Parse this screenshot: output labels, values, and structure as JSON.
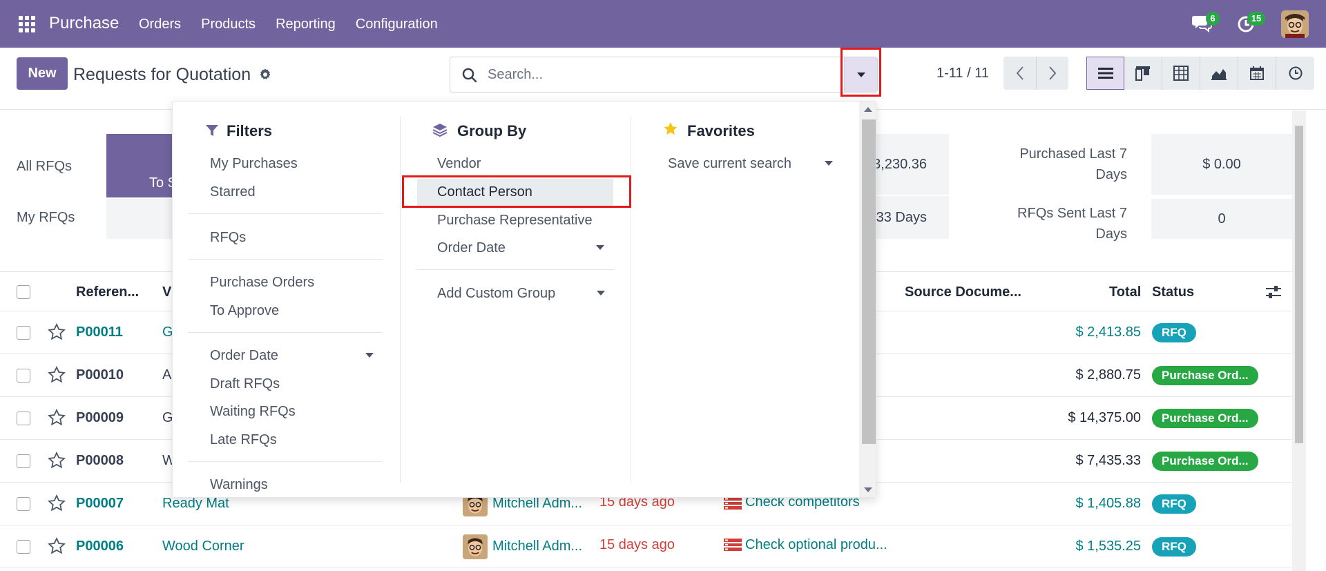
{
  "navbar": {
    "brand": "Purchase",
    "menu": [
      "Orders",
      "Products",
      "Reporting",
      "Configuration"
    ],
    "chat_count": "6",
    "activity_count": "15"
  },
  "control": {
    "new_label": "New",
    "title": "Requests for Quotation",
    "search_placeholder": "Search...",
    "pager": "1-11 / 11"
  },
  "dashboard": {
    "all_rfqs": "All RFQs",
    "my_rfqs": "My RFQs",
    "todo_top": "",
    "todo_label": "To S",
    "mid_value_1": "3,230.36",
    "mid_value_2": "33 Days",
    "purchased_last_7_days_line1": "Purchased Last 7",
    "purchased_last_7_days_line2": "Days",
    "purchased_value": "$ 0.00",
    "rfqs_sent_line1": "RFQs Sent Last 7",
    "rfqs_sent_line2": "Days",
    "rfqs_sent_value": "0"
  },
  "table": {
    "headers": {
      "reference": "Referen...",
      "vendor": "V",
      "source": "Source Docume...",
      "total": "Total",
      "status": "Status"
    },
    "rows": [
      {
        "ref": "P00011",
        "vendor": "G",
        "agent": "",
        "deadline": "",
        "source": "",
        "total": "$ 2,413.85",
        "status": "RFQ",
        "kind": "rfq"
      },
      {
        "ref": "P00010",
        "vendor": "A",
        "agent": "",
        "deadline": "",
        "source": "",
        "total": "$ 2,880.75",
        "status": "Purchase Ord...",
        "kind": "po"
      },
      {
        "ref": "P00009",
        "vendor": "G",
        "agent": "",
        "deadline": "",
        "source": "",
        "total": "$ 14,375.00",
        "status": "Purchase Ord...",
        "kind": "po"
      },
      {
        "ref": "P00008",
        "vendor": "W",
        "agent": "",
        "deadline": "",
        "source": "",
        "total": "$ 7,435.33",
        "status": "Purchase Ord...",
        "kind": "po"
      },
      {
        "ref": "P00007",
        "vendor": "Ready Mat",
        "agent": "Mitchell Adm...",
        "deadline": "15 days ago",
        "source": "Check competitors",
        "total": "$ 1,405.88",
        "status": "RFQ",
        "kind": "rfq"
      },
      {
        "ref": "P00006",
        "vendor": "Wood Corner",
        "agent": "Mitchell Adm...",
        "deadline": "15 days ago",
        "source": "Check optional produ...",
        "total": "$ 1,535.25",
        "status": "RFQ",
        "kind": "rfq"
      }
    ]
  },
  "dropdown": {
    "filters": {
      "title": "Filters",
      "items": [
        "My Purchases",
        "Starred",
        "RFQs",
        "Purchase Orders",
        "To Approve",
        "Order Date",
        "Draft RFQs",
        "Waiting RFQs",
        "Late RFQs",
        "Warnings"
      ]
    },
    "group_by": {
      "title": "Group By",
      "items": [
        "Vendor",
        "Contact Person",
        "Purchase Representative",
        "Order Date",
        "Add Custom Group"
      ]
    },
    "favorites": {
      "title": "Favorites",
      "items": [
        "Save current search"
      ]
    }
  },
  "colors": {
    "brand": "#71639e",
    "link": "#017e84",
    "rfq": "#17a2b8",
    "po": "#28a745",
    "overdue": "#d23f3a",
    "highlight_box": "#e3191c"
  }
}
